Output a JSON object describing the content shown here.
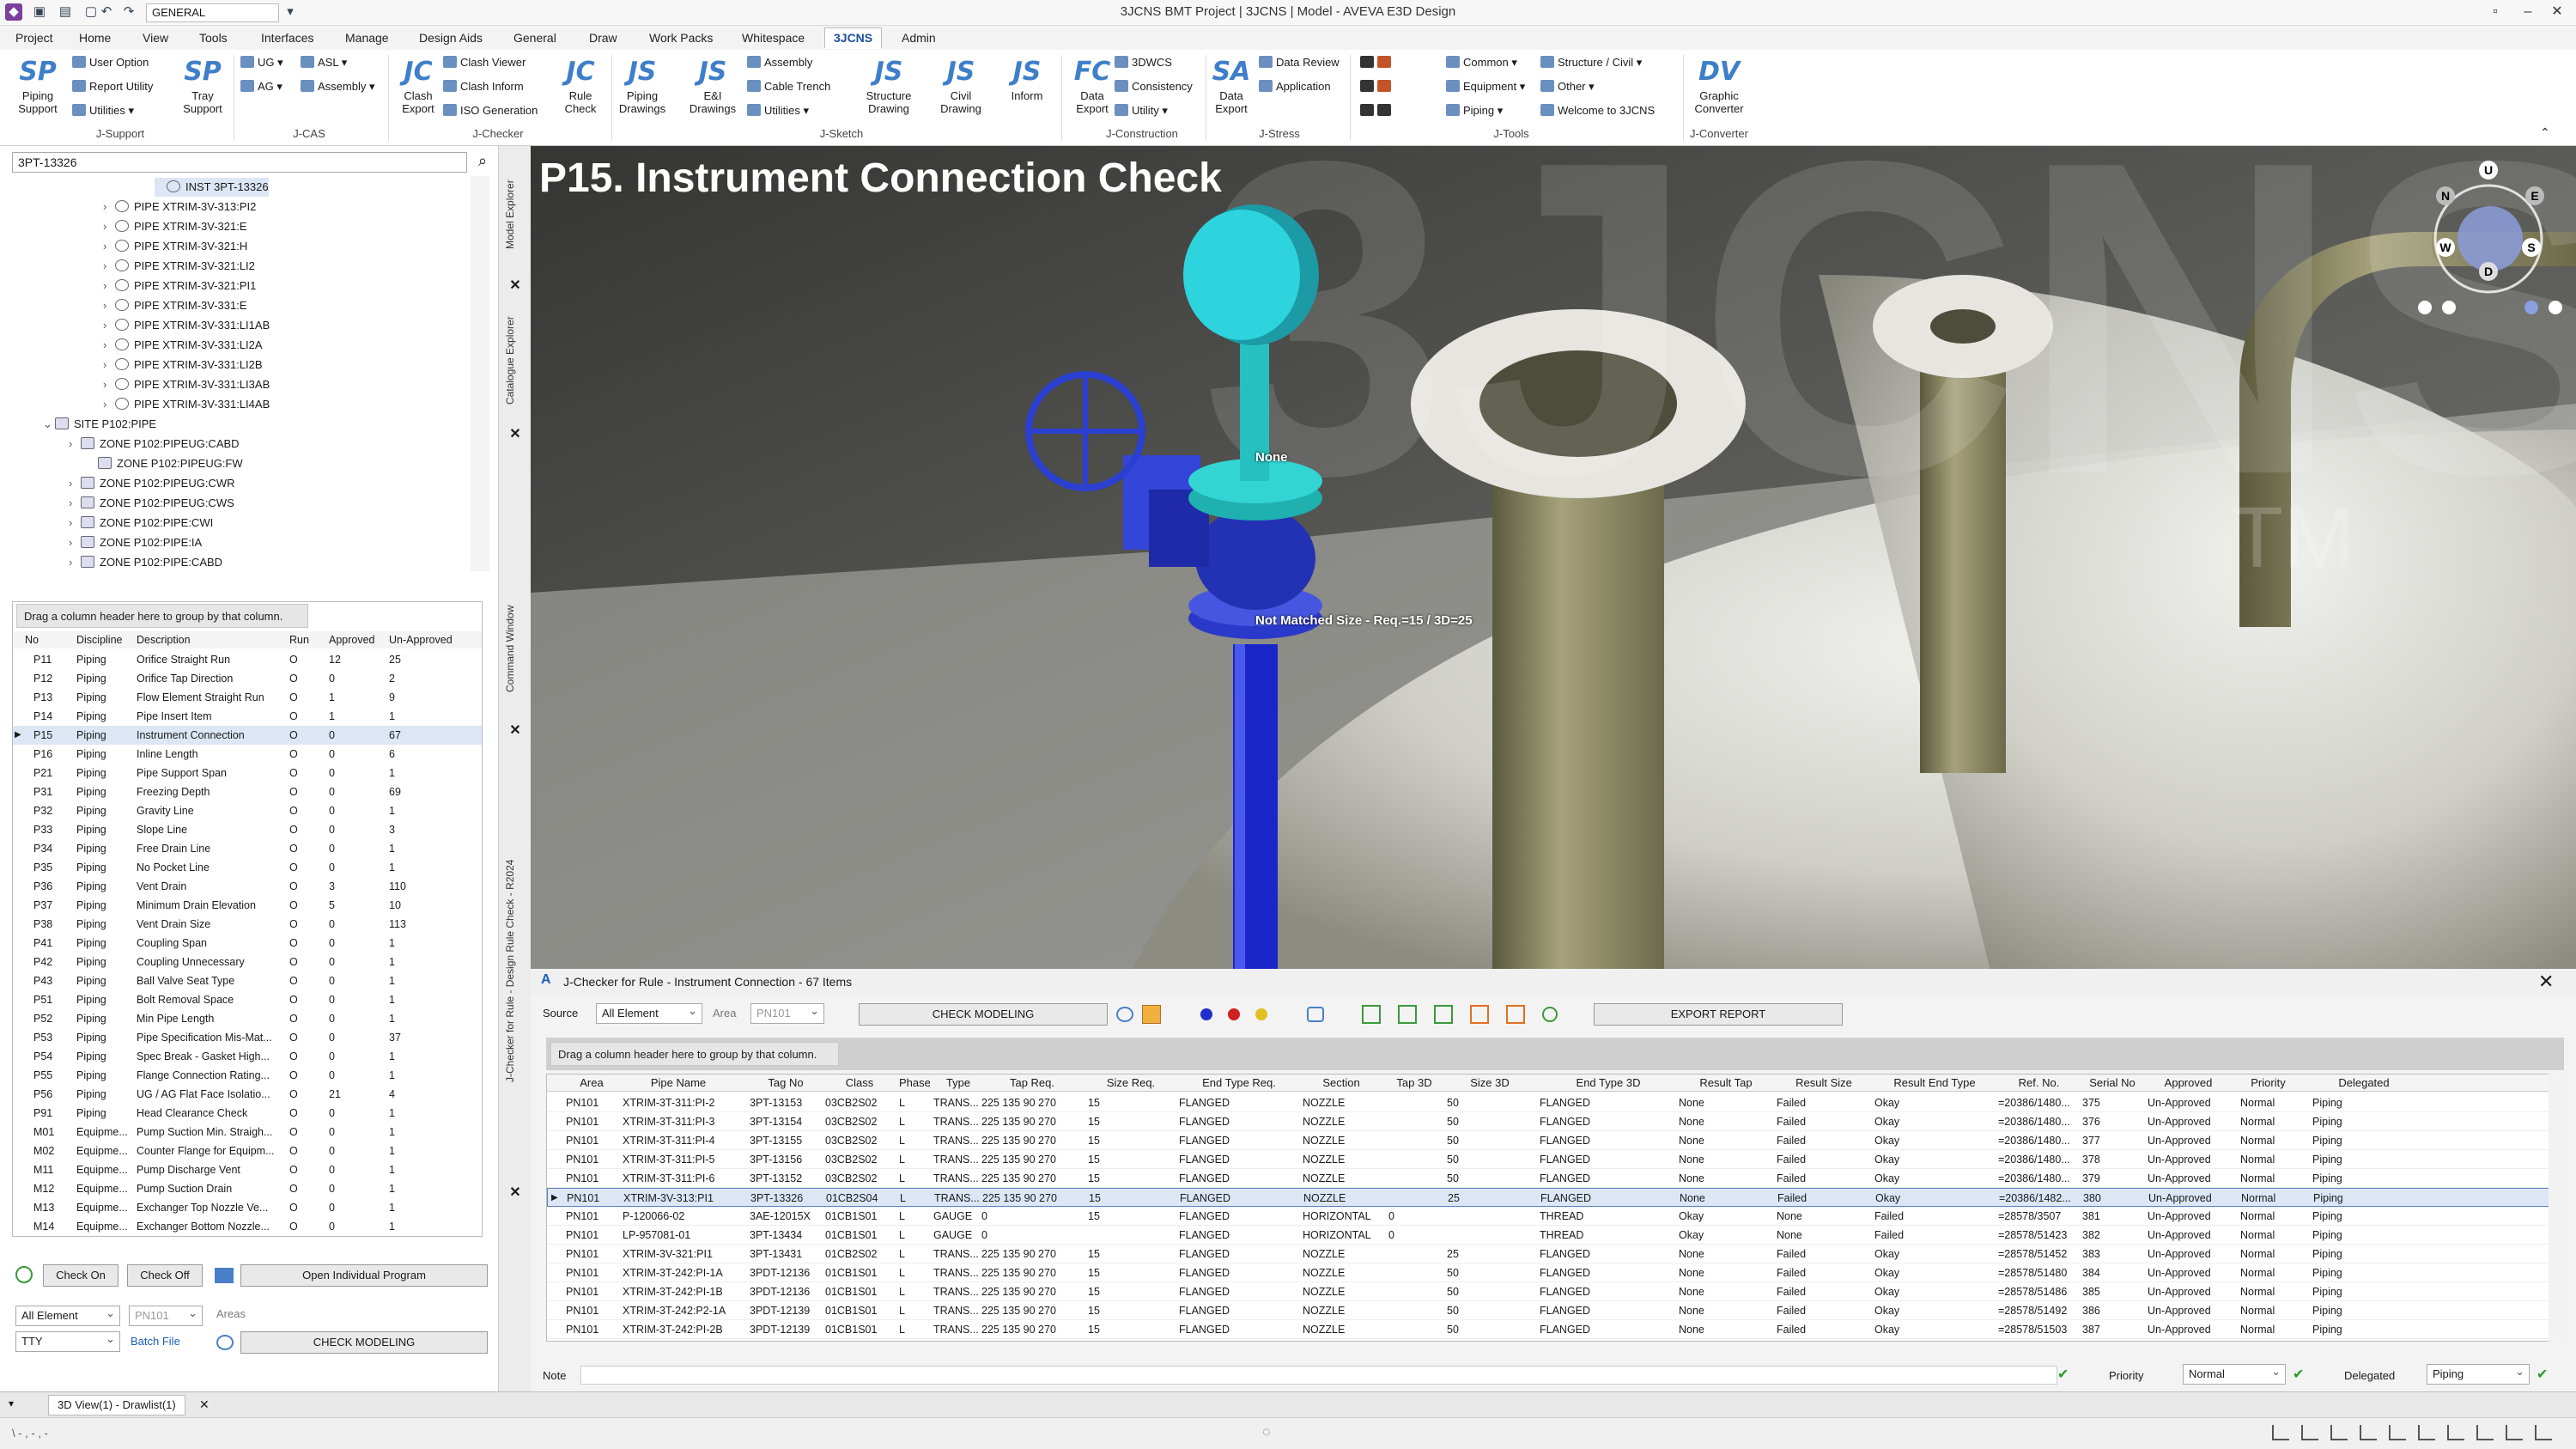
{
  "titlebar": {
    "title": "3JCNS BMT Project | 3JCNS | Model - AVEVA E3D Design",
    "combo": "GENERAL"
  },
  "menu": [
    "Project",
    "Home",
    "View",
    "Tools",
    "Interfaces",
    "Manage",
    "Design Aids",
    "General",
    "Draw",
    "Work Packs",
    "Whitespace",
    "3JCNS",
    "Admin"
  ],
  "ribbon": {
    "piping_support": "Piping Support",
    "user_option": "User Option",
    "report_utility": "Report Utility",
    "utilities": "Utilities",
    "tray_support": "Tray Support",
    "g_jsupport": "J-Support",
    "ug": "UG",
    "asl": "ASL",
    "ag": "AG",
    "assembly": "Assembly",
    "g_jcas": "J-CAS",
    "clash_export": "Clash Export",
    "clash_viewer": "Clash Viewer",
    "clash_inform": "Clash Inform",
    "iso_generation": "ISO Generation",
    "rule_check": "Rule Check",
    "g_jchecker": "J-Checker",
    "piping_drawings": "Piping Drawings",
    "el_drawings": "E&I Drawings",
    "sk_assembly": "Assembly",
    "cable_trench": "Cable Trench",
    "sk_utilities": "Utilities",
    "structure_drawing": "Structure Drawing",
    "civil_drawing": "Civil Drawing",
    "inform": "Inform",
    "g_jsketch": "J-Sketch",
    "data_export": "Data Export",
    "wcs3d": "3DWCS",
    "consistency": "Consistency",
    "utility": "Utility",
    "g_jconstruction": "J-Construction",
    "stress_export": "Data Export",
    "data_review": "Data Review",
    "application": "Application",
    "g_jstress": "J-Stress",
    "common": "Common",
    "structure_civil": "Structure / Civil",
    "equipment": "Equipment",
    "other": "Other",
    "piping": "Piping",
    "welcome": "Welcome to 3JCNS",
    "g_jtools": "J-Tools",
    "graphic_converter": "Graphic Converter",
    "g_jconverter": "J-Converter"
  },
  "explorer": {
    "search": "3PT-13326",
    "tree": [
      "INST 3PT-13326",
      "PIPE XTRIM-3V-313:PI2",
      "PIPE XTRIM-3V-321:E",
      "PIPE XTRIM-3V-321:H",
      "PIPE XTRIM-3V-321:LI2",
      "PIPE XTRIM-3V-321:PI1",
      "PIPE XTRIM-3V-331:E",
      "PIPE XTRIM-3V-331:LI1AB",
      "PIPE XTRIM-3V-331:LI2A",
      "PIPE XTRIM-3V-331:LI2B",
      "PIPE XTRIM-3V-331:LI3AB",
      "PIPE XTRIM-3V-331:LI4AB",
      "SITE P102:PIPE",
      "ZONE P102:PIPEUG:CABD",
      "ZONE P102:PIPEUG:FW",
      "ZONE P102:PIPEUG:CWR",
      "ZONE P102:PIPEUG:CWS",
      "ZONE P102:PIPE:CWI",
      "ZONE P102:PIPE:IA",
      "ZONE P102:PIPE:CABD"
    ],
    "side_tabs": [
      "Model Explorer",
      "Catalogue Explorer",
      "Command Window",
      "J-Checker for Rule - Design Rule Check - R2024"
    ]
  },
  "rules": {
    "group_hint": "Drag a column header here to group by that column.",
    "headers": [
      "No",
      "Discipline",
      "Description",
      "Run",
      "Approved",
      "Un-Approved"
    ],
    "rows": [
      [
        "P11",
        "Piping",
        "Orifice Straight Run",
        "O",
        "12",
        "25"
      ],
      [
        "P12",
        "Piping",
        "Orifice Tap Direction",
        "O",
        "0",
        "2"
      ],
      [
        "P13",
        "Piping",
        "Flow Element Straight Run",
        "O",
        "1",
        "9"
      ],
      [
        "P14",
        "Piping",
        "Pipe Insert Item",
        "O",
        "1",
        "1"
      ],
      [
        "P15",
        "Piping",
        "Instrument Connection",
        "O",
        "0",
        "67"
      ],
      [
        "P16",
        "Piping",
        "Inline Length",
        "O",
        "0",
        "6"
      ],
      [
        "P21",
        "Piping",
        "Pipe Support Span",
        "O",
        "0",
        "1"
      ],
      [
        "P31",
        "Piping",
        "Freezing Depth",
        "O",
        "0",
        "69"
      ],
      [
        "P32",
        "Piping",
        "Gravity Line",
        "O",
        "0",
        "1"
      ],
      [
        "P33",
        "Piping",
        "Slope Line",
        "O",
        "0",
        "3"
      ],
      [
        "P34",
        "Piping",
        "Free Drain Line",
        "O",
        "0",
        "1"
      ],
      [
        "P35",
        "Piping",
        "No Pocket Line",
        "O",
        "0",
        "1"
      ],
      [
        "P36",
        "Piping",
        "Vent Drain",
        "O",
        "3",
        "110"
      ],
      [
        "P37",
        "Piping",
        "Minimum Drain Elevation",
        "O",
        "5",
        "10"
      ],
      [
        "P38",
        "Piping",
        "Vent Drain Size",
        "O",
        "0",
        "113"
      ],
      [
        "P41",
        "Piping",
        "Coupling Span",
        "O",
        "0",
        "1"
      ],
      [
        "P42",
        "Piping",
        "Coupling Unnecessary",
        "O",
        "0",
        "1"
      ],
      [
        "P43",
        "Piping",
        "Ball Valve Seat Type",
        "O",
        "0",
        "1"
      ],
      [
        "P51",
        "Piping",
        "Bolt Removal Space",
        "O",
        "0",
        "1"
      ],
      [
        "P52",
        "Piping",
        "Min Pipe Length",
        "O",
        "0",
        "1"
      ],
      [
        "P53",
        "Piping",
        "Pipe Specification Mis-Mat...",
        "O",
        "0",
        "37"
      ],
      [
        "P54",
        "Piping",
        "Spec Break - Gasket High...",
        "O",
        "0",
        "1"
      ],
      [
        "P55",
        "Piping",
        "Flange Connection Rating...",
        "O",
        "0",
        "1"
      ],
      [
        "P56",
        "Piping",
        "UG / AG Flat Face Isolatio...",
        "O",
        "21",
        "4"
      ],
      [
        "P91",
        "Piping",
        "Head Clearance Check",
        "O",
        "0",
        "1"
      ],
      [
        "M01",
        "Equipme...",
        "Pump Suction Min. Straigh...",
        "O",
        "0",
        "1"
      ],
      [
        "M02",
        "Equipme...",
        "Counter Flange for Equipm...",
        "O",
        "0",
        "1"
      ],
      [
        "M11",
        "Equipme...",
        "Pump Discharge Vent",
        "O",
        "0",
        "1"
      ],
      [
        "M12",
        "Equipme...",
        "Pump Suction Drain",
        "O",
        "0",
        "1"
      ],
      [
        "M13",
        "Equipme...",
        "Exchanger Top Nozzle Ve...",
        "O",
        "0",
        "1"
      ],
      [
        "M14",
        "Equipme...",
        "Exchanger Bottom Nozzle...",
        "O",
        "0",
        "1"
      ]
    ]
  },
  "leftctl": {
    "check_on": "Check On",
    "check_off": "Check Off",
    "open_individual": "Open Individual Program",
    "all_element": "All Element",
    "area_code": "PN101",
    "areas": "Areas",
    "tty": "TTY",
    "batch_file": "Batch File",
    "check_modeling": "CHECK MODELING"
  },
  "viewport": {
    "title": "P15. Instrument Connection Check",
    "label_none": "None",
    "label_mismatch": "Not Matched Size - Req.=15 / 3D=25",
    "watermark": "3JCNS",
    "tm": "TM",
    "cube": [
      "U",
      "N",
      "E",
      "W",
      "S",
      "D"
    ]
  },
  "checker": {
    "title": "J-Checker for Rule - Instrument Connection - 67 Items",
    "source_lbl": "Source",
    "source": "All Element",
    "area_lbl": "Area",
    "area": "PN101",
    "check_modeling": "CHECK MODELING",
    "export_report": "EXPORT REPORT",
    "group_hint": "Drag a column header here to group by that column.",
    "headers": [
      "Area",
      "Pipe Name",
      "Tag No",
      "Class",
      "Phase",
      "Type",
      "Tap Req.",
      "Size Req.",
      "End Type Req.",
      "Section",
      "Tap 3D",
      "Size 3D",
      "End Type 3D",
      "Result Tap",
      "Result Size",
      "Result End Type",
      "Ref. No.",
      "Serial No",
      "Approved",
      "Priority",
      "Delegated"
    ],
    "rows": [
      [
        "PN101",
        "XTRIM-3T-311:PI-2",
        "3PT-13153",
        "03CB2S02",
        "L",
        "TRANS...",
        "225 135 90 270",
        "15",
        "FLANGED",
        "NOZZLE",
        "",
        "50",
        "FLANGED",
        "None",
        "Failed",
        "Okay",
        "=20386/1480...",
        "375",
        "Un-Approved",
        "Normal",
        "Piping"
      ],
      [
        "PN101",
        "XTRIM-3T-311:PI-3",
        "3PT-13154",
        "03CB2S02",
        "L",
        "TRANS...",
        "225 135 90 270",
        "15",
        "FLANGED",
        "NOZZLE",
        "",
        "50",
        "FLANGED",
        "None",
        "Failed",
        "Okay",
        "=20386/1480...",
        "376",
        "Un-Approved",
        "Normal",
        "Piping"
      ],
      [
        "PN101",
        "XTRIM-3T-311:PI-4",
        "3PT-13155",
        "03CB2S02",
        "L",
        "TRANS...",
        "225 135 90 270",
        "15",
        "FLANGED",
        "NOZZLE",
        "",
        "50",
        "FLANGED",
        "None",
        "Failed",
        "Okay",
        "=20386/1480...",
        "377",
        "Un-Approved",
        "Normal",
        "Piping"
      ],
      [
        "PN101",
        "XTRIM-3T-311:PI-5",
        "3PT-13156",
        "03CB2S02",
        "L",
        "TRANS...",
        "225 135 90 270",
        "15",
        "FLANGED",
        "NOZZLE",
        "",
        "50",
        "FLANGED",
        "None",
        "Failed",
        "Okay",
        "=20386/1480...",
        "378",
        "Un-Approved",
        "Normal",
        "Piping"
      ],
      [
        "PN101",
        "XTRIM-3T-311:PI-6",
        "3PT-13152",
        "03CB2S02",
        "L",
        "TRANS...",
        "225 135 90 270",
        "15",
        "FLANGED",
        "NOZZLE",
        "",
        "50",
        "FLANGED",
        "None",
        "Failed",
        "Okay",
        "=20386/1480...",
        "379",
        "Un-Approved",
        "Normal",
        "Piping"
      ],
      [
        "PN101",
        "XTRIM-3V-313:PI1",
        "3PT-13326",
        "01CB2S04",
        "L",
        "TRANS...",
        "225 135 90 270",
        "15",
        "FLANGED",
        "NOZZLE",
        "",
        "25",
        "FLANGED",
        "None",
        "Failed",
        "Okay",
        "=20386/1482...",
        "380",
        "Un-Approved",
        "Normal",
        "Piping"
      ],
      [
        "PN101",
        "P-120066-02",
        "3AE-12015X",
        "01CB1S01",
        "L",
        "GAUGE",
        "0",
        "15",
        "FLANGED",
        "HORIZONTAL",
        "0",
        "",
        "THREAD",
        "Okay",
        "None",
        "Failed",
        "=28578/3507",
        "381",
        "Un-Approved",
        "Normal",
        "Piping"
      ],
      [
        "PN101",
        "LP-957081-01",
        "3PT-13434",
        "01CB1S01",
        "L",
        "GAUGE",
        "0",
        "",
        "FLANGED",
        "HORIZONTAL",
        "0",
        "",
        "THREAD",
        "Okay",
        "None",
        "Failed",
        "=28578/51423",
        "382",
        "Un-Approved",
        "Normal",
        "Piping"
      ],
      [
        "PN101",
        "XTRIM-3V-321:PI1",
        "3PT-13431",
        "01CB2S02",
        "L",
        "TRANS...",
        "225 135 90 270",
        "15",
        "FLANGED",
        "NOZZLE",
        "",
        "25",
        "FLANGED",
        "None",
        "Failed",
        "Okay",
        "=28578/51452",
        "383",
        "Un-Approved",
        "Normal",
        "Piping"
      ],
      [
        "PN101",
        "XTRIM-3T-242:PI-1A",
        "3PDT-12136",
        "01CB1S01",
        "L",
        "TRANS...",
        "225 135 90 270",
        "15",
        "FLANGED",
        "NOZZLE",
        "",
        "50",
        "FLANGED",
        "None",
        "Failed",
        "Okay",
        "=28578/51480",
        "384",
        "Un-Approved",
        "Normal",
        "Piping"
      ],
      [
        "PN101",
        "XTRIM-3T-242:PI-1B",
        "3PDT-12136",
        "01CB1S01",
        "L",
        "TRANS...",
        "225 135 90 270",
        "15",
        "FLANGED",
        "NOZZLE",
        "",
        "50",
        "FLANGED",
        "None",
        "Failed",
        "Okay",
        "=28578/51486",
        "385",
        "Un-Approved",
        "Normal",
        "Piping"
      ],
      [
        "PN101",
        "XTRIM-3T-242:P2-1A",
        "3PDT-12139",
        "01CB1S01",
        "L",
        "TRANS...",
        "225 135 90 270",
        "15",
        "FLANGED",
        "NOZZLE",
        "",
        "50",
        "FLANGED",
        "None",
        "Failed",
        "Okay",
        "=28578/51492",
        "386",
        "Un-Approved",
        "Normal",
        "Piping"
      ],
      [
        "PN101",
        "XTRIM-3T-242:PI-2B",
        "3PDT-12139",
        "01CB1S01",
        "L",
        "TRANS...",
        "225 135 90 270",
        "15",
        "FLANGED",
        "NOZZLE",
        "",
        "50",
        "FLANGED",
        "None",
        "Failed",
        "Okay",
        "=28578/51503",
        "387",
        "Un-Approved",
        "Normal",
        "Piping"
      ]
    ],
    "note_lbl": "Note",
    "priority_lbl": "Priority",
    "priority": "Normal",
    "delegated_lbl": "Delegated",
    "delegated": "Piping"
  },
  "tabs": {
    "view_tab": "3D View(1) - Drawlist(1)"
  },
  "status": {
    "left": "\\ - , - , -"
  }
}
